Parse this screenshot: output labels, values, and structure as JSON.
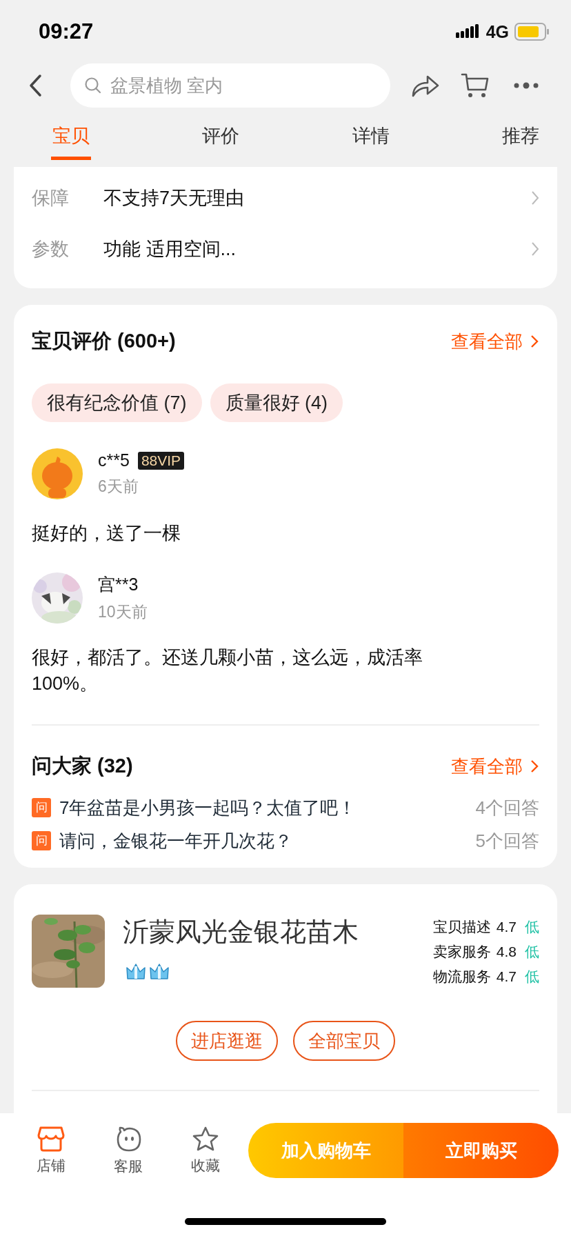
{
  "status_bar": {
    "time": "09:27",
    "network": "4G"
  },
  "search": {
    "placeholder": "盆景植物 室内"
  },
  "tabs": [
    {
      "label": "宝贝",
      "selected": true
    },
    {
      "label": "评价",
      "selected": false
    },
    {
      "label": "详情",
      "selected": false
    },
    {
      "label": "推荐",
      "selected": false
    }
  ],
  "info_rows": [
    {
      "label": "保障",
      "value": "不支持7天无理由"
    },
    {
      "label": "参数",
      "value": "功能 适用空间..."
    }
  ],
  "reviews": {
    "title": "宝贝评价 (600+)",
    "view_all": "查看全部",
    "tags": [
      "很有纪念价值 (7)",
      "质量很好 (4)"
    ],
    "items": [
      {
        "user": "c**5",
        "badge": "88VIP",
        "kind": "cartoon",
        "time": "6天前",
        "text": "挺好的，送了一棵"
      },
      {
        "user": "宫**3",
        "kind": "picture",
        "time": "10天前",
        "text": "很好，都活了。还送几颗小苗，这么远，成活率100%。"
      }
    ]
  },
  "questions": {
    "title": "问大家 (32)",
    "view_all": "查看全部",
    "items": [
      {
        "icon": "问",
        "text": "7年盆苗是小男孩一起吗？太值了吧！",
        "answers": "4个回答"
      },
      {
        "icon": "问",
        "text": "请问，金银花一年开几次花？",
        "answers": "5个回答"
      }
    ]
  },
  "shop": {
    "name": "沂蒙风光金银花苗木",
    "badges": [
      {
        "kind": "crown"
      },
      {
        "kind": "crown"
      }
    ],
    "ratings": [
      {
        "label": "宝贝描述",
        "score": "4.7",
        "level_text": "低"
      },
      {
        "label": "卖家服务",
        "score": "4.8",
        "level_text": "低"
      },
      {
        "label": "物流服务",
        "score": "4.7",
        "level_text": "低"
      }
    ],
    "buttons": [
      "进店逛逛",
      "全部宝贝"
    ]
  },
  "bottom_bar": {
    "items": [
      {
        "kind": "store",
        "label": "店铺"
      },
      {
        "kind": "service",
        "label": "客服"
      },
      {
        "kind": "favorite",
        "label": "收藏"
      }
    ],
    "add_to_cart": "加入购物车",
    "buy_now": "立即购买"
  }
}
